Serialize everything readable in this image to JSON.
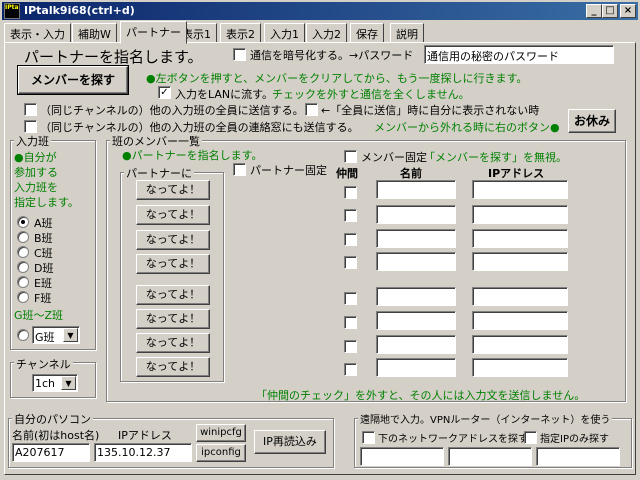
{
  "window": {
    "title": "IPtalk9i68(ctrl+d)",
    "app_icon_text": "IPtalk",
    "minimize_glyph": "_",
    "maximize_glyph": "□",
    "close_glyph": "×"
  },
  "tabs": [
    {
      "label": "表示・入力"
    },
    {
      "label": "補助W"
    },
    {
      "label": "パートナー"
    },
    {
      "label": "表示1"
    },
    {
      "label": "表示2"
    },
    {
      "label": "入力1"
    },
    {
      "label": "入力2"
    },
    {
      "label": "保存"
    },
    {
      "label": "説明"
    }
  ],
  "active_tab": "パートナー",
  "header": {
    "heading": "パートナーを指名します。",
    "encrypt_label": "通信を暗号化する。→パスワード",
    "encrypt_checked": false,
    "password_value": "通信用の秘密のパスワード"
  },
  "member_search": {
    "button_label": "メンバーを探す",
    "hint": "●左ボタンを押すと、メンバーをクリアしてから、もう一度探しに行きます。",
    "lan_label": "入力をLANに流す。",
    "lan_checked": true,
    "lan_hint": "チェックを外すと通信を全くしません。"
  },
  "broadcast": {
    "send_all_label": "（同じチャンネルの）他の入力班の全員に送信する。",
    "send_all_checked": false,
    "self_label": "←「全員に送信」時に自分に表示されない時",
    "self_checked": false,
    "contact_label": "（同じチャンネルの）他の入力班の全員の連絡窓にも送信する。",
    "contact_checked": false,
    "rest_hint": "メンバーから外れる時に右のボタン●",
    "rest_button": "お休み"
  },
  "input_team": {
    "title": "入力班",
    "hint_lines": [
      "●自分が",
      "参加する",
      "入力班を",
      "指定します。"
    ],
    "options": [
      "A班",
      "B班",
      "C班",
      "D班",
      "E班",
      "F班"
    ],
    "selected": "A班",
    "gz_label": "G班～Z班",
    "gz_value": "G班"
  },
  "channel": {
    "title": "チャンネル",
    "value": "1ch"
  },
  "team_members": {
    "title": "班のメンバー一覧",
    "hint": "●パートナーを指名します。",
    "partner_group_title": "パートナーに",
    "partner_button_label": "なってよ！",
    "partner_fixed_label": "パートナー固定",
    "partner_fixed_checked": false,
    "member_fixed_label": "メンバー固定",
    "member_fixed_checked": false,
    "member_fixed_hint": "「メンバーを探す」を無視。",
    "col_nakama": "仲間",
    "col_name": "名前",
    "col_ip": "IPアドレス",
    "rows": [
      {
        "name": "",
        "ip": "",
        "checked": false
      },
      {
        "name": "",
        "ip": "",
        "checked": false
      },
      {
        "name": "",
        "ip": "",
        "checked": false
      },
      {
        "name": "",
        "ip": "",
        "checked": false
      },
      {
        "name": "",
        "ip": "",
        "checked": false
      },
      {
        "name": "",
        "ip": "",
        "checked": false
      },
      {
        "name": "",
        "ip": "",
        "checked": false
      },
      {
        "name": "",
        "ip": "",
        "checked": false
      }
    ],
    "footer_hint": "「仲間のチェック」を外すと、その人には入力文を送信しません。"
  },
  "my_pc": {
    "title": "自分のパソコン",
    "name_label": "名前(初はhost名)",
    "ip_label": "IPアドレス",
    "name_value": "A207617",
    "ip_value": "135.10.12.37",
    "winipcfg_button": "winipcfg",
    "ipconfig_button": "ipconfig",
    "reload_button": "IP再読込み"
  },
  "remote": {
    "title": "遠隔地で入力。VPNルーター（インターネット）を使う",
    "search_network_label": "下のネットワークアドレスを探す",
    "search_network_checked": false,
    "only_ip_label": "指定IPのみ探す",
    "only_ip_checked": false,
    "fields": [
      "",
      "",
      ""
    ]
  },
  "icons": {
    "check_glyph": "✓",
    "dropdown_glyph": "▼"
  }
}
